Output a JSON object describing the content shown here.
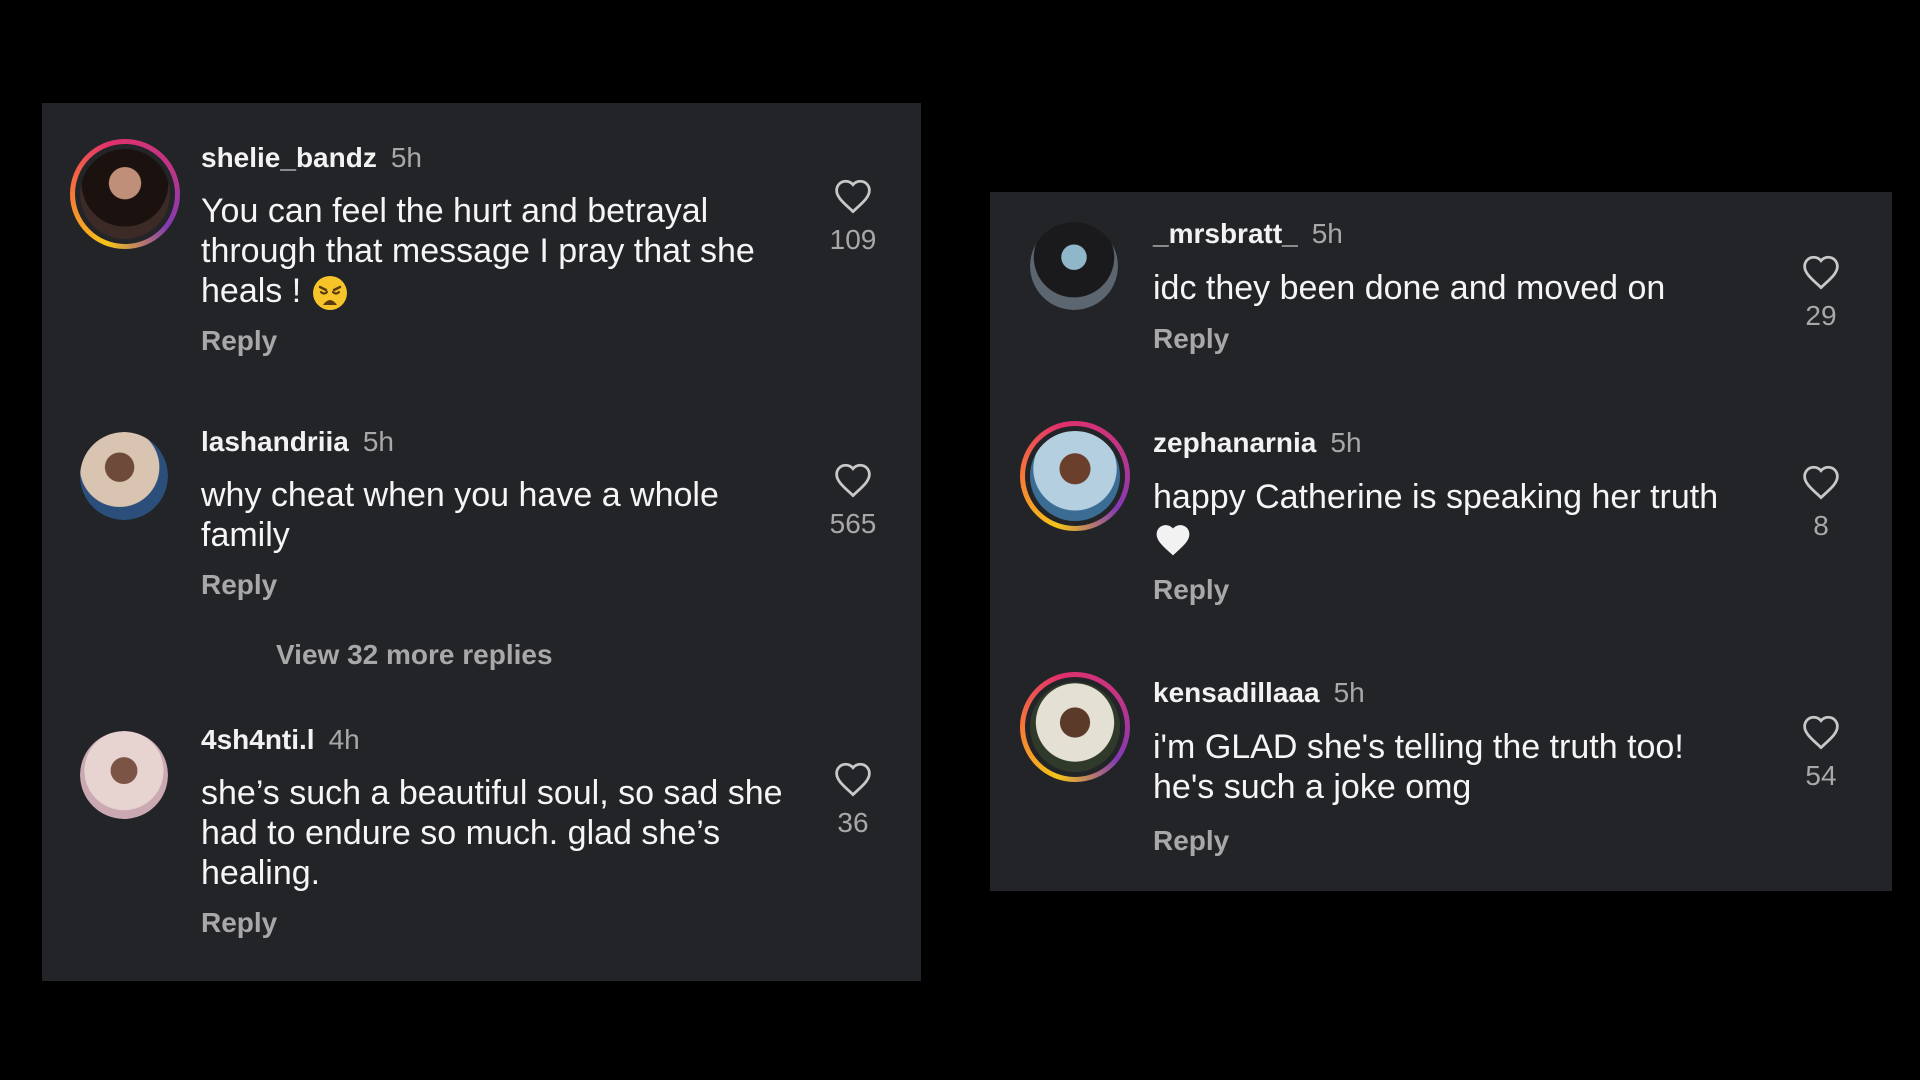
{
  "left_panel": {
    "comments": [
      {
        "username": "shelie_bandz",
        "time": "5h",
        "text": "You can feel the hurt and betrayal through that message I pray that she heals !",
        "emoji": "weary-face",
        "reply_label": "Reply",
        "likes": "109",
        "avatar_ring": true
      },
      {
        "username": "lashandriia",
        "time": "5h",
        "text": "why cheat when you have a whole family",
        "reply_label": "Reply",
        "likes": "565",
        "avatar_ring": false
      },
      {
        "username": "4sh4nti.l",
        "time": "4h",
        "text": "she’s such a beautiful soul, so sad she had to endure so much. glad she’s healing.",
        "reply_label": "Reply",
        "likes": "36",
        "avatar_ring": false
      }
    ],
    "view_more_replies": "View 32 more replies"
  },
  "right_panel": {
    "comments": [
      {
        "username": "_mrsbratt_",
        "time": "5h",
        "text": "idc they been done and moved on",
        "reply_label": "Reply",
        "likes": "29",
        "avatar_ring": false
      },
      {
        "username": "zephanarnia",
        "time": "5h",
        "text": "happy Catherine is speaking her truth",
        "emoji": "white-heart",
        "reply_label": "Reply",
        "likes": "8",
        "avatar_ring": true
      },
      {
        "username": "kensadillaaa",
        "time": "5h",
        "text": "i'm GLAD she's telling the truth too! he's such a joke omg",
        "reply_label": "Reply",
        "likes": "54",
        "avatar_ring": true
      }
    ]
  },
  "colors": {
    "background": "#000000",
    "panel": "#232428",
    "primary_text": "#f5f5f5",
    "secondary_text": "#a8a8a8"
  }
}
